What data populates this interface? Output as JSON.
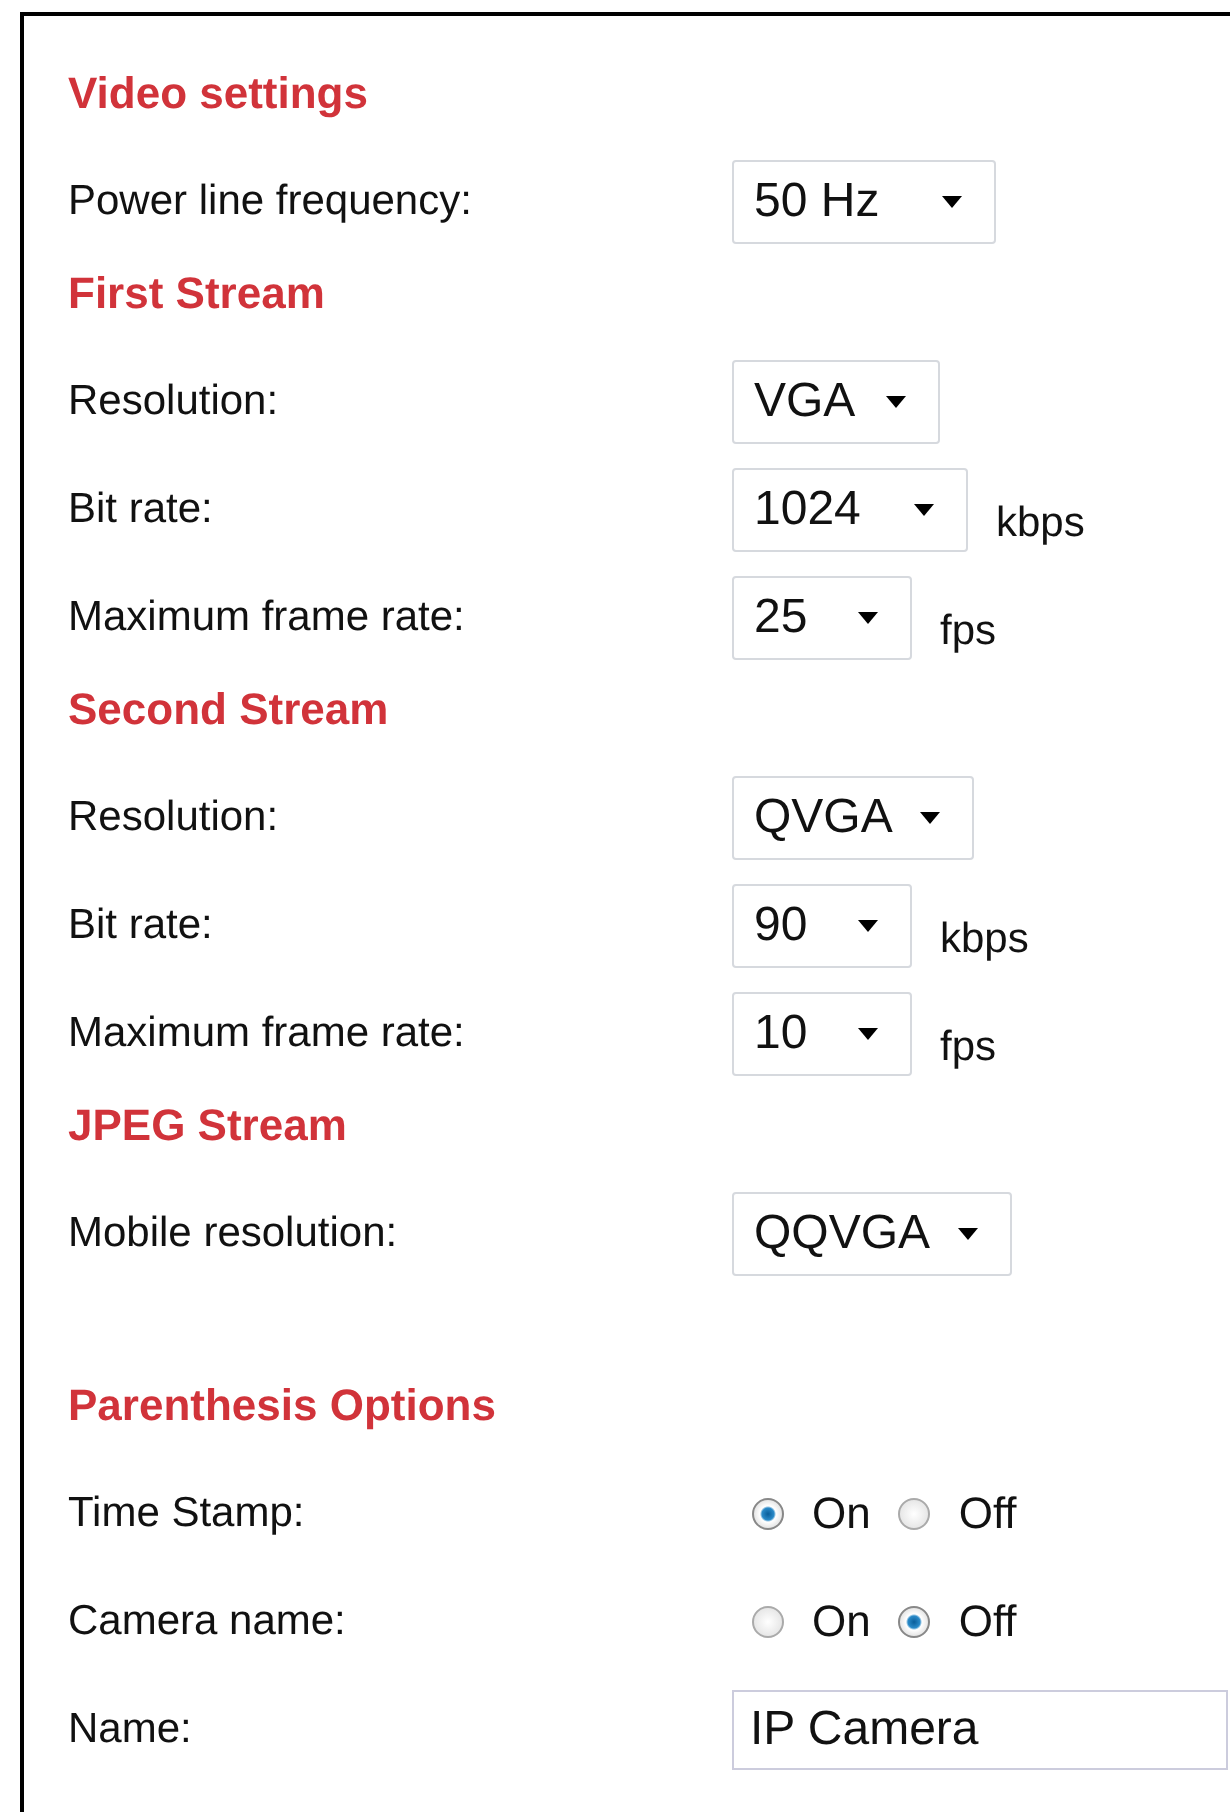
{
  "sections": [
    {
      "title": "Video settings",
      "rows": [
        {
          "kind": "select",
          "label": "Power line frequency:",
          "value": "50 Hz"
        }
      ]
    },
    {
      "title": "First Stream",
      "rows": [
        {
          "kind": "select",
          "label": "Resolution:",
          "value": "VGA"
        },
        {
          "kind": "select",
          "label": "Bit rate:",
          "value": "1024",
          "unit": "kbps"
        },
        {
          "kind": "select",
          "label": "Maximum frame rate:",
          "value": "25",
          "unit": "fps"
        }
      ]
    },
    {
      "title": "Second Stream",
      "rows": [
        {
          "kind": "select",
          "label": "Resolution:",
          "value": "QVGA"
        },
        {
          "kind": "select",
          "label": "Bit rate:",
          "value": "90",
          "unit": "kbps"
        },
        {
          "kind": "select",
          "label": "Maximum frame rate:",
          "value": "10",
          "unit": "fps"
        }
      ]
    },
    {
      "title": "JPEG Stream",
      "rows": [
        {
          "kind": "select",
          "label": "Mobile resolution:",
          "value": "QQVGA"
        }
      ]
    },
    {
      "title": "Parenthesis Options",
      "rows": [
        {
          "kind": "radio",
          "label": "Time Stamp:",
          "options": [
            {
              "label": "On",
              "selected": true
            },
            {
              "label": "Off",
              "selected": false
            }
          ]
        },
        {
          "kind": "radio",
          "label": "Camera name:",
          "options": [
            {
              "label": "On",
              "selected": false
            },
            {
              "label": "Off",
              "selected": true
            }
          ]
        },
        {
          "kind": "text",
          "label": "Name:",
          "value": "IP Camera"
        }
      ]
    }
  ]
}
